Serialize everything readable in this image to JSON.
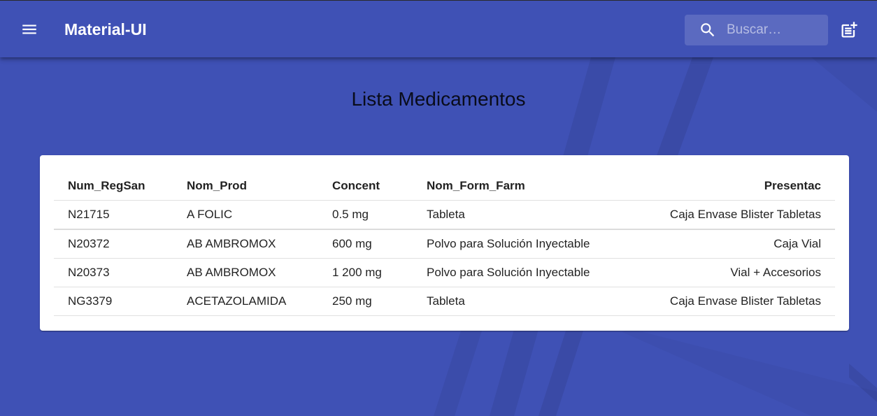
{
  "appbar": {
    "title": "Material-UI",
    "menu_icon": "menu-icon",
    "search": {
      "icon": "search-icon",
      "placeholder": "Buscar…",
      "value": ""
    },
    "add_icon": "post-add-icon"
  },
  "page": {
    "title": "Lista Medicamentos"
  },
  "table": {
    "headers": [
      "Num_RegSan",
      "Nom_Prod",
      "Concent",
      "Nom_Form_Farm",
      "Presentac"
    ],
    "rows": [
      [
        "N21715",
        "A FOLIC",
        "0.5 mg",
        "Tableta",
        "Caja Envase Blister Tabletas"
      ],
      [
        "N20372",
        "AB AMBROMOX",
        "600 mg",
        "Polvo para Solución Inyectable",
        "Caja Vial"
      ],
      [
        "N20373",
        "AB AMBROMOX",
        "1 200 mg",
        "Polvo para Solución Inyectable",
        "Vial + Accesorios"
      ],
      [
        "NG3379",
        "ACETAZOLAMIDA",
        "250 mg",
        "Tableta",
        "Caja Envase Blister Tabletas"
      ]
    ]
  },
  "colors": {
    "primary": "#3f51b5",
    "card": "#ffffff",
    "text": "#212121"
  }
}
